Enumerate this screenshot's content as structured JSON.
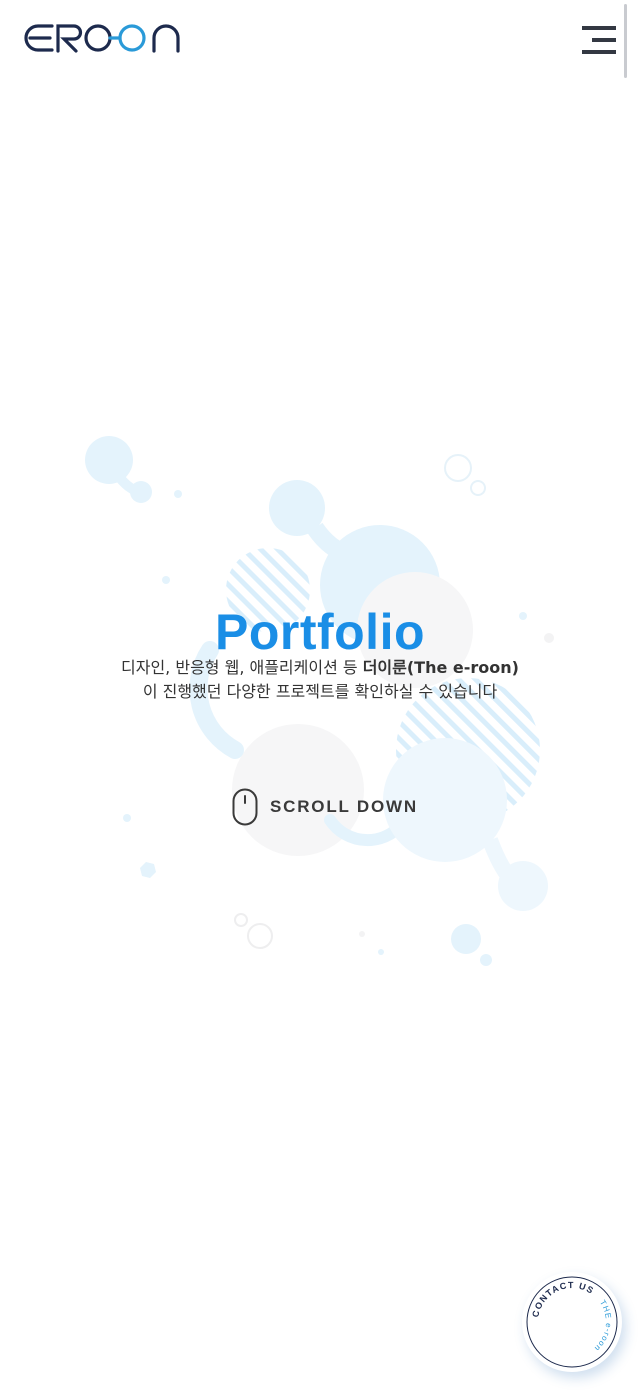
{
  "header": {
    "logo_text": "EROON",
    "menu_icon": "hamburger-menu-icon"
  },
  "hero": {
    "title": "Portfolio",
    "desc_line1_prefix": "디자인, 반응형 웹, 애플리케이션 등 ",
    "desc_line1_bold": "더이룬(The e-roon)",
    "desc_line2": "이 진행했던 다양한 프로젝트를 확인하실 수 있습니다"
  },
  "scroll": {
    "label": "SCROLL DOWN",
    "icon": "mouse-icon"
  },
  "contact": {
    "primary_text": "CONTACT US",
    "secondary_text": "THE e-roon"
  },
  "colors": {
    "accent": "#1a8ee6",
    "logo_dark": "#1d2a4d",
    "logo_blue": "#2a9ad8",
    "bubble": "#e4f3fc",
    "text": "#333333"
  }
}
